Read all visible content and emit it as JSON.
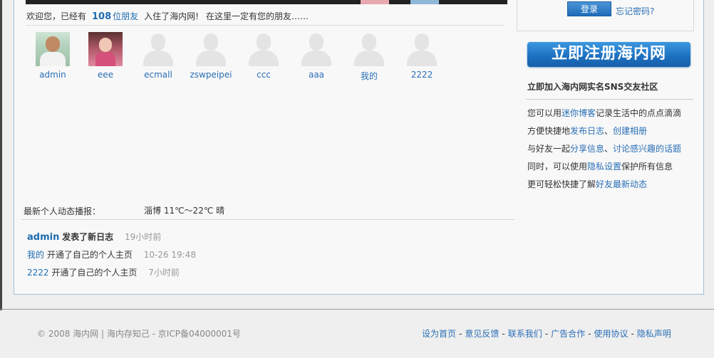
{
  "welcome": {
    "prefix": "欢迎您，已经有",
    "count": "108",
    "friend_word": "位朋友",
    "joined": "入住了海内网!",
    "tagline": "在这里一定有您的朋友……"
  },
  "users": [
    {
      "name": "admin",
      "avatar": "photo-admin"
    },
    {
      "name": "eee",
      "avatar": "photo-eee"
    },
    {
      "name": "ecmall",
      "avatar": "silhouette"
    },
    {
      "name": "zswpeipei",
      "avatar": "silhouette"
    },
    {
      "name": "ccc",
      "avatar": "silhouette"
    },
    {
      "name": "aaa",
      "avatar": "silhouette"
    },
    {
      "name": "我的",
      "avatar": "silhouette"
    },
    {
      "name": "2222",
      "avatar": "silhouette"
    }
  ],
  "feed": {
    "heading": "最新个人动态播报：",
    "weather": "淄博 11℃～22℃ 晴",
    "items": [
      {
        "user": "admin",
        "action": "发表了新日志",
        "time": "19小时前"
      },
      {
        "user": "我的",
        "action": "开通了自己的个人主页",
        "time": "10-26 19:48"
      },
      {
        "user": "2222",
        "action": "开通了自己的个人主页",
        "time": "7小时前"
      }
    ]
  },
  "login": {
    "button": "登录",
    "forgot": "忘记密码?"
  },
  "register": {
    "banner": "立即注册海内网",
    "title": "立即加入海内网实名SNS交友社区"
  },
  "features": {
    "l1_a": "您可以用",
    "l1_link": "迷你博客",
    "l1_b": "记录生活中的点点滴滴",
    "l2_a": "方便快捷地",
    "l2_link1": "发布日志",
    "l2_sep": "、",
    "l2_link2": "创建相册",
    "l3_a": "与好友一起",
    "l3_link1": "分享信息",
    "l3_sep": "、",
    "l3_link2": "讨论感兴趣的话题",
    "l4_a": "同时，可以使用",
    "l4_link": "隐私设置",
    "l4_b": "保护所有信息",
    "l5_a": "更可轻松快捷了解",
    "l5_link": "好友最新动态"
  },
  "footer": {
    "copyright": "© 2008 海内网 | 海内存知己 - 京ICP备04000001号",
    "links": [
      "设为首页",
      "意见反馈",
      "联系我们",
      "广告合作",
      "使用协议",
      "隐私声明"
    ],
    "separator": "-"
  },
  "colors": {
    "link": "#2a6fb6",
    "accent": "#1f6cb9",
    "frame_border": "#9ec0dc"
  }
}
